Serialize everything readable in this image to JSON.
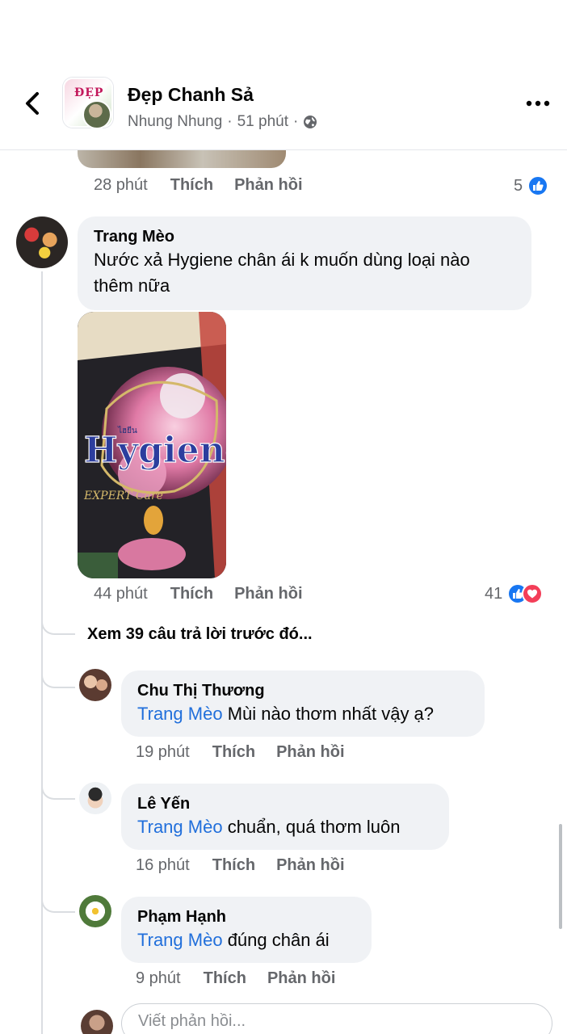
{
  "header": {
    "group_name": "Đẹp Chanh Sả",
    "group_avatar_text": "ĐẸP",
    "author": "Nhung Nhung",
    "time": "51 phút",
    "separator": "·"
  },
  "actions": {
    "like": "Thích",
    "reply": "Phản hồi"
  },
  "previous_comment": {
    "time": "28 phút",
    "reaction_count": "5"
  },
  "main_comment": {
    "name": "Trang Mèo",
    "text": "Nước xả Hygiene chân ái k muốn dùng loại nào thêm nữa",
    "text_line1": "Nước xả Hygiene chân ái k muốn dùng loại nào",
    "text_line2": "thêm nữa",
    "image_brand": "Hygiene",
    "image_sub": "EXPERT Care",
    "image_small": "ไฮยีน",
    "time": "44 phút",
    "reaction_count": "41"
  },
  "view_previous": "Xem 39 câu trả lời trước đó...",
  "replies": [
    {
      "name": "Chu Thị Thương",
      "mention": "Trang Mèo",
      "text": " Mùi nào thơm nhất vậy ạ?",
      "time": "19 phút"
    },
    {
      "name": "Lê Yến",
      "mention": "Trang Mèo",
      "text": " chuẩn, quá thơm luôn",
      "time": "16 phút"
    },
    {
      "name": "Phạm Hạnh",
      "mention": "Trang Mèo",
      "text": " đúng chân ái",
      "time": "9 phút"
    }
  ],
  "composer": {
    "placeholder": "Viết phản hồi..."
  },
  "colors": {
    "like_blue": "#1877f2",
    "love_red": "#f33e58",
    "mention_blue": "#216fdb",
    "bubble_gray": "#f0f2f5"
  },
  "icons": [
    "back-arrow-icon",
    "globe-icon",
    "more-dots-icon",
    "like-reaction-icon",
    "love-reaction-icon"
  ]
}
